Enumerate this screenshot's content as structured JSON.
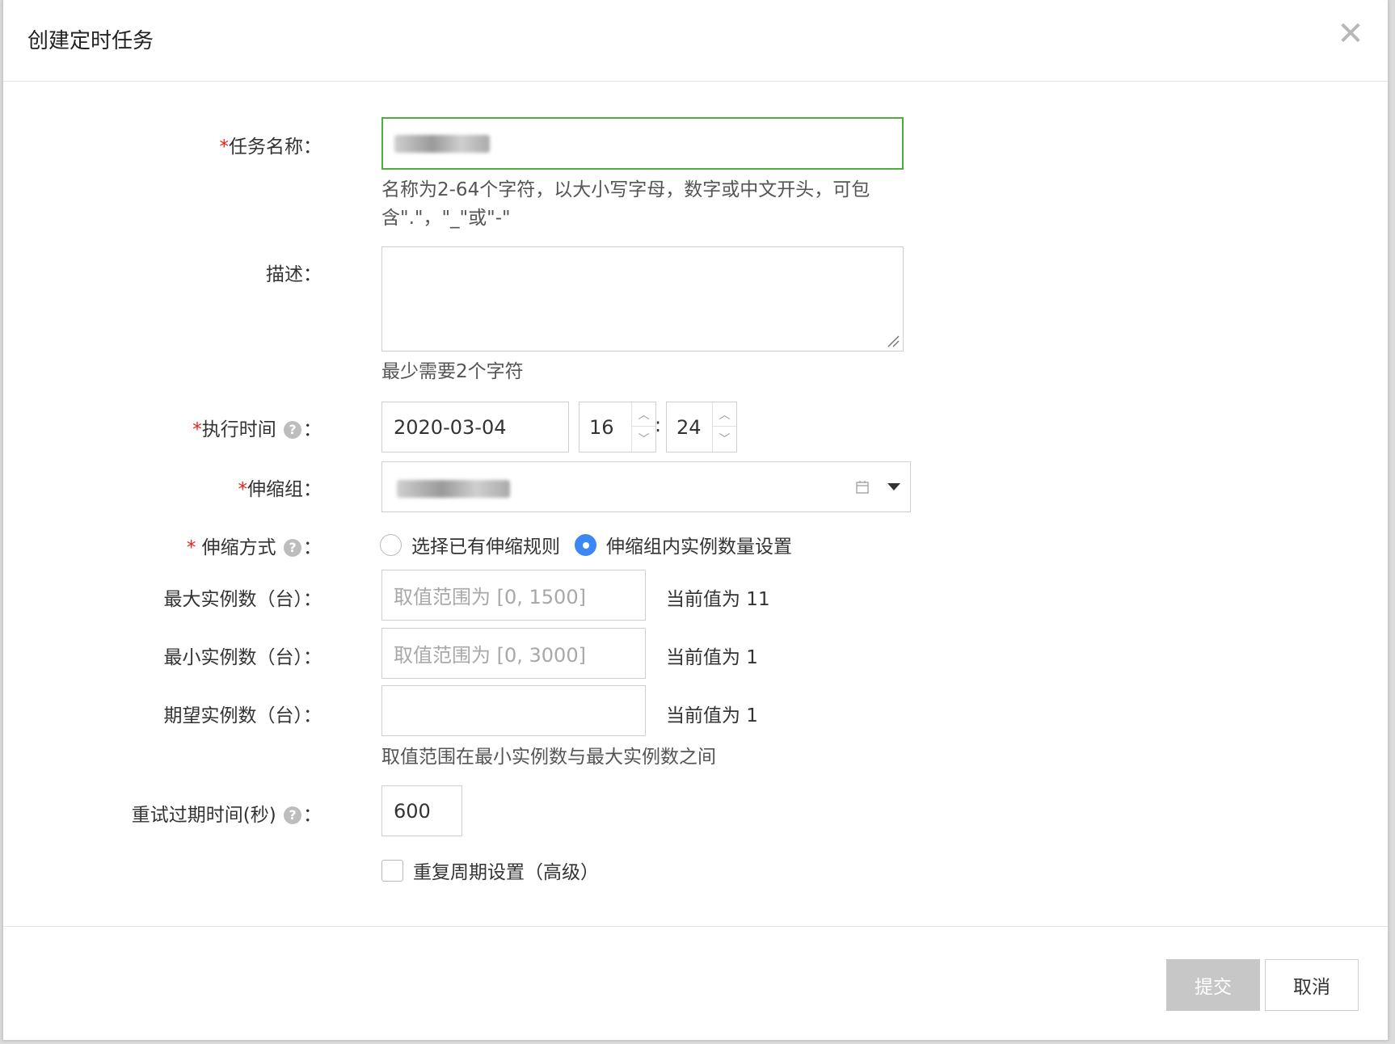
{
  "dialog": {
    "title": "创建定时任务",
    "close_glyph": "✕"
  },
  "form": {
    "task_name": {
      "label": "任务名称：",
      "required_mark": "*",
      "hint": "名称为2-64个字符，以大小写字母，数字或中文开头，可包含\".\"，\"_\"或\"-\""
    },
    "description": {
      "label": "描述：",
      "value": "",
      "hint": "最少需要2个字符"
    },
    "exec_time": {
      "label": "执行时间",
      "required_mark": "*",
      "help": "?",
      "colon": "：",
      "date": "2020-03-04",
      "hour": "16",
      "minute": "24",
      "separator": ":"
    },
    "scaling_group": {
      "label": "伸缩组：",
      "required_mark": "*"
    },
    "scaling_mode": {
      "label": " 伸缩方式",
      "required_mark": "*",
      "help": "?",
      "colon": "：",
      "options": [
        "选择已有伸缩规则",
        "伸缩组内实例数量设置"
      ],
      "selected_index": 1
    },
    "max_instances": {
      "label": "最大实例数（台）：",
      "placeholder": "取值范围为 [0, 1500]",
      "current": "当前值为 11"
    },
    "min_instances": {
      "label": "最小实例数（台）：",
      "placeholder": "取值范围为 [0, 3000]",
      "current": "当前值为 1"
    },
    "desired_instances": {
      "label": "期望实例数（台）：",
      "value": "",
      "current": "当前值为 1",
      "hint": "取值范围在最小实例数与最大实例数之间"
    },
    "retry_expire": {
      "label": "重试过期时间(秒)",
      "help": "?",
      "colon": "：",
      "value": "600"
    },
    "repeat": {
      "label": "重复周期设置（高级）",
      "checked": false
    }
  },
  "footer": {
    "submit_label": "提交",
    "cancel_label": "取消"
  },
  "colors": {
    "required": "#e1251b",
    "focus_border": "#4cae3a",
    "radio_checked": "#3d87f5",
    "submit_disabled": "#c7c7c7"
  }
}
